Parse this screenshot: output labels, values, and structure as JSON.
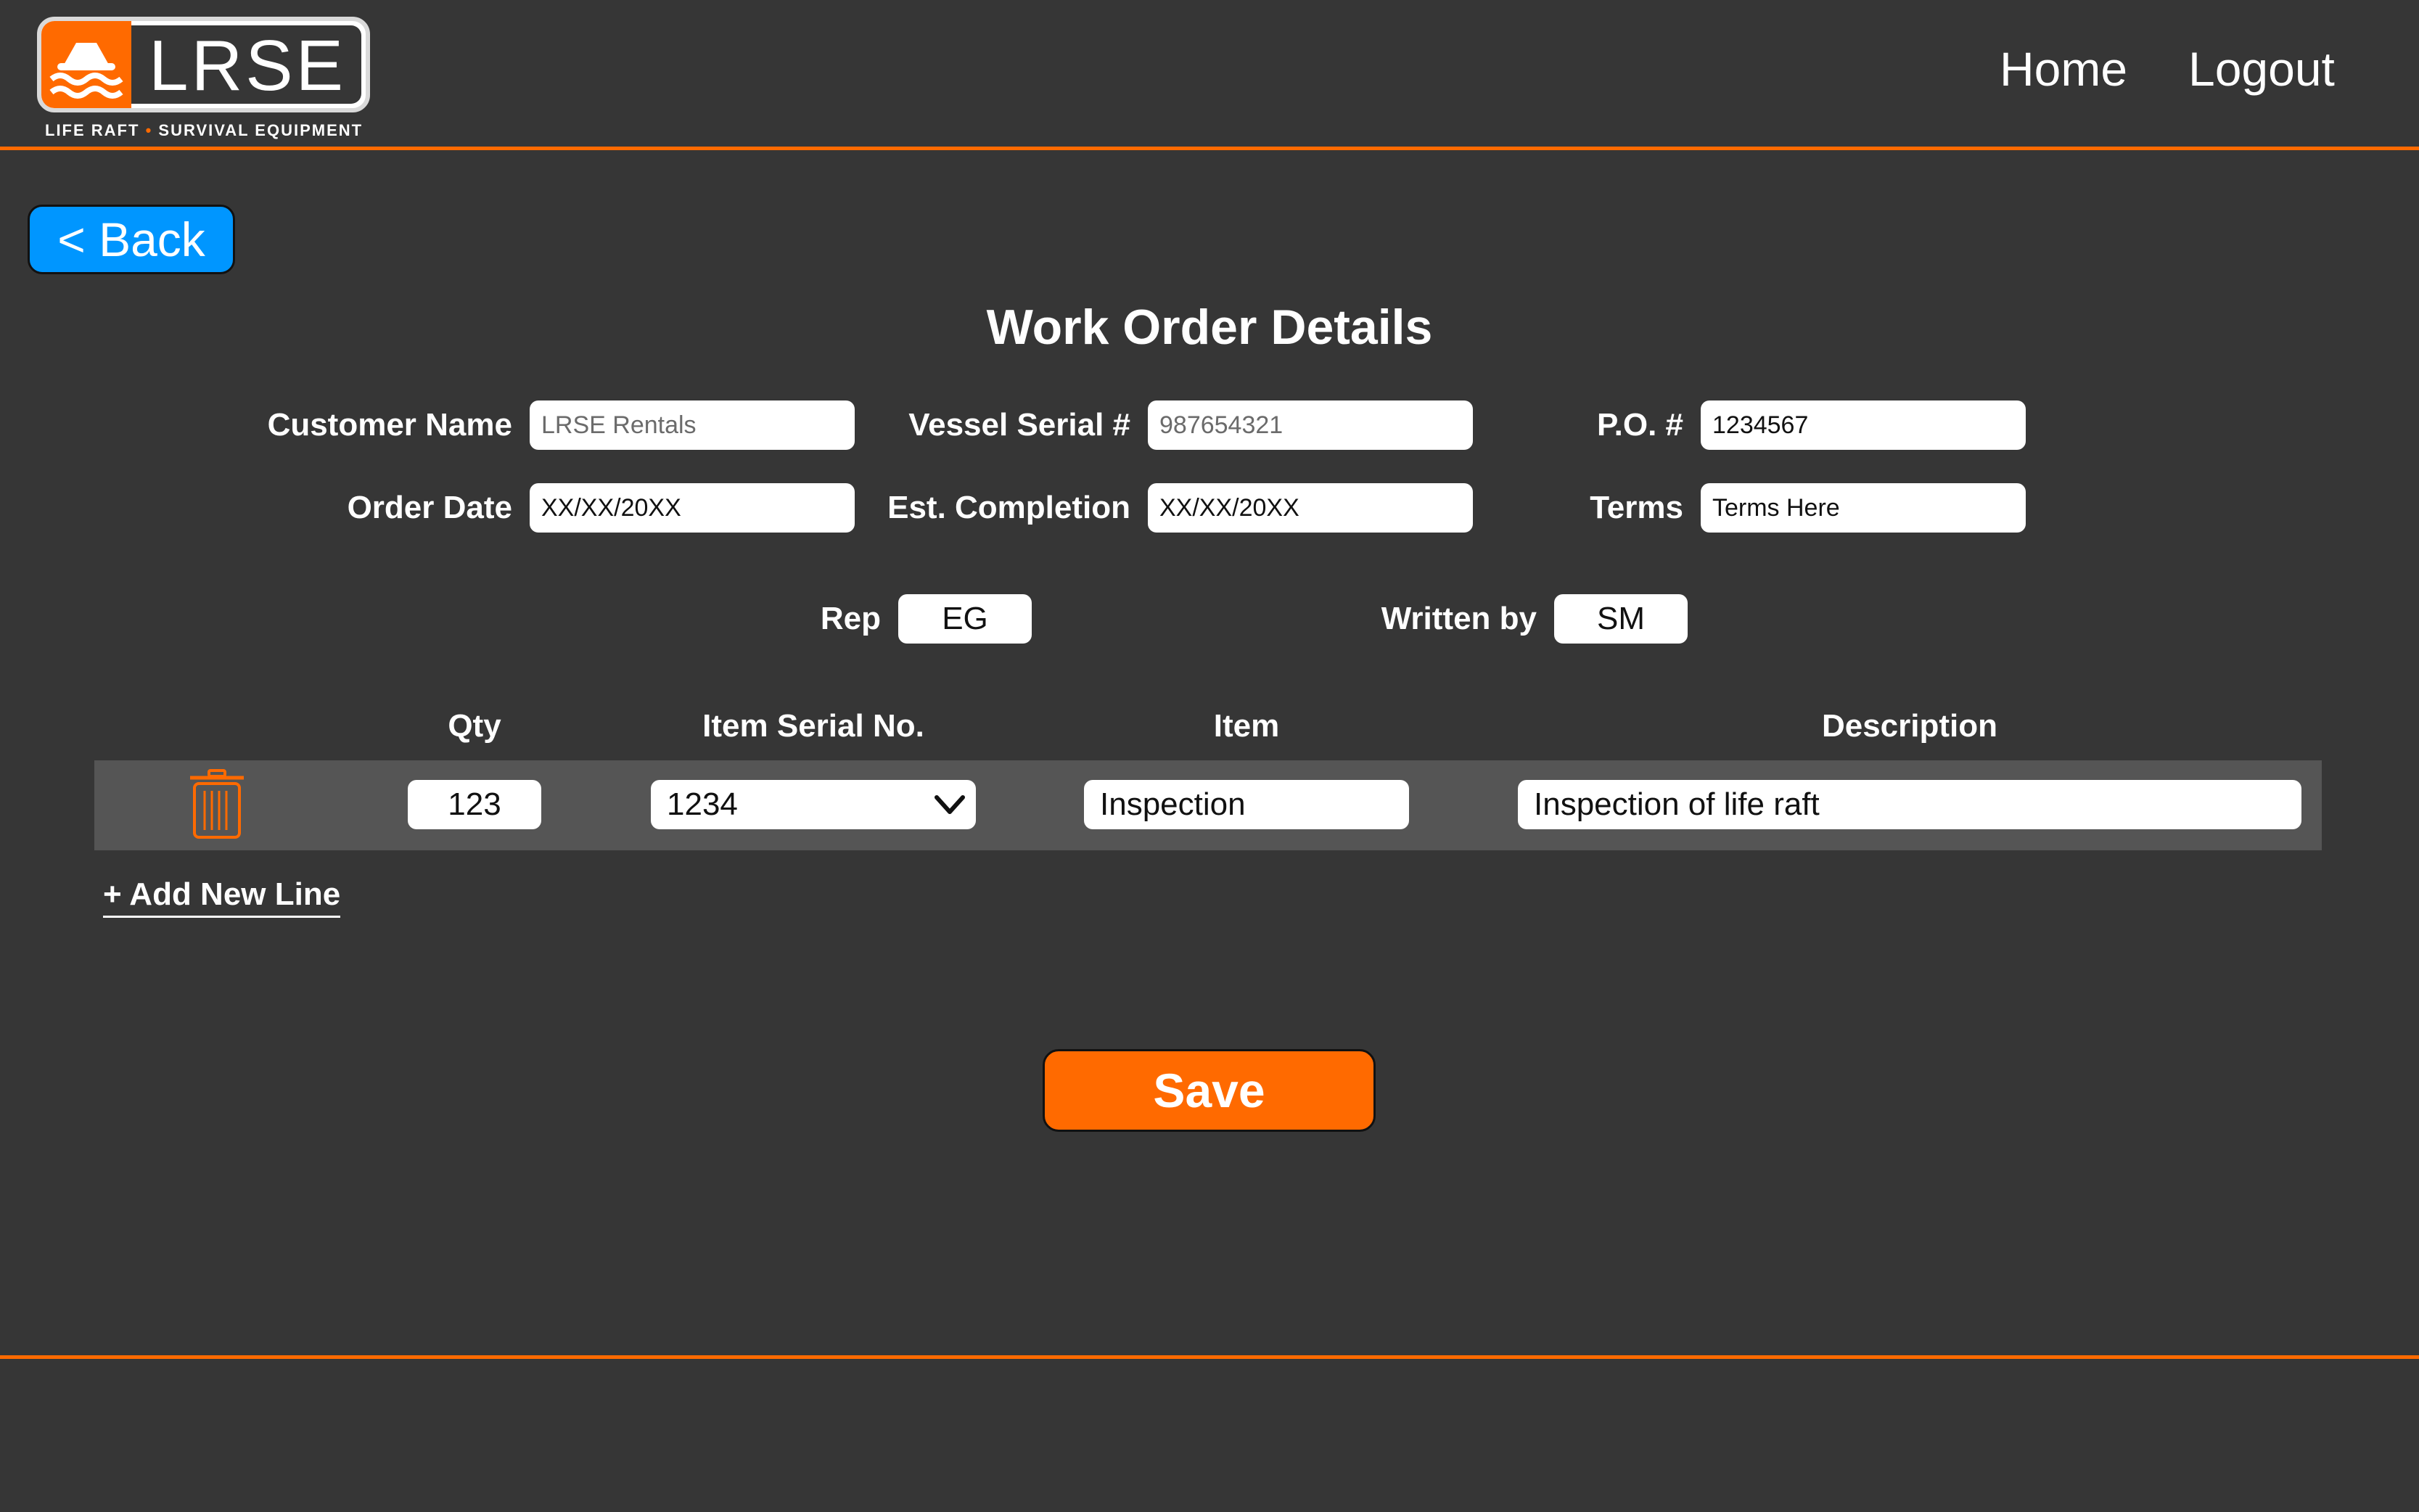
{
  "header": {
    "brand": "LRSE",
    "tagline_left": "LIFE RAFT",
    "tagline_sep": "•",
    "tagline_right": "SURVIVAL EQUIPMENT",
    "nav": {
      "home": "Home",
      "logout": "Logout"
    }
  },
  "back_button": "< Back",
  "page_title": "Work Order Details",
  "form": {
    "customer_name": {
      "label": "Customer Name",
      "placeholder": "LRSE Rentals"
    },
    "vessel_serial": {
      "label": "Vessel Serial #",
      "placeholder": "987654321"
    },
    "po": {
      "label": "P.O. #",
      "value": "1234567"
    },
    "order_date": {
      "label": "Order Date",
      "value": "XX/XX/20XX"
    },
    "est_completion": {
      "label": "Est. Completion",
      "value": "XX/XX/20XX"
    },
    "terms": {
      "label": "Terms",
      "value": "Terms Here"
    },
    "rep": {
      "label": "Rep",
      "value": "EG"
    },
    "written_by": {
      "label": "Written by",
      "value": "SM"
    }
  },
  "table": {
    "headers": {
      "qty": "Qty",
      "serial": "Item Serial No.",
      "item": "Item",
      "description": "Description"
    },
    "rows": [
      {
        "qty": "123",
        "serial": "1234",
        "item": "Inspection",
        "description": "Inspection of life raft"
      }
    ]
  },
  "add_line": "+ Add New Line",
  "save_button": "Save",
  "colors": {
    "accent": "#ff6a00",
    "back": "#0096ff",
    "background": "#363636",
    "row": "#555555"
  },
  "icons": {
    "delete": "trash-icon",
    "dropdown": "chevron-down-icon",
    "logo": "life-raft-icon"
  }
}
